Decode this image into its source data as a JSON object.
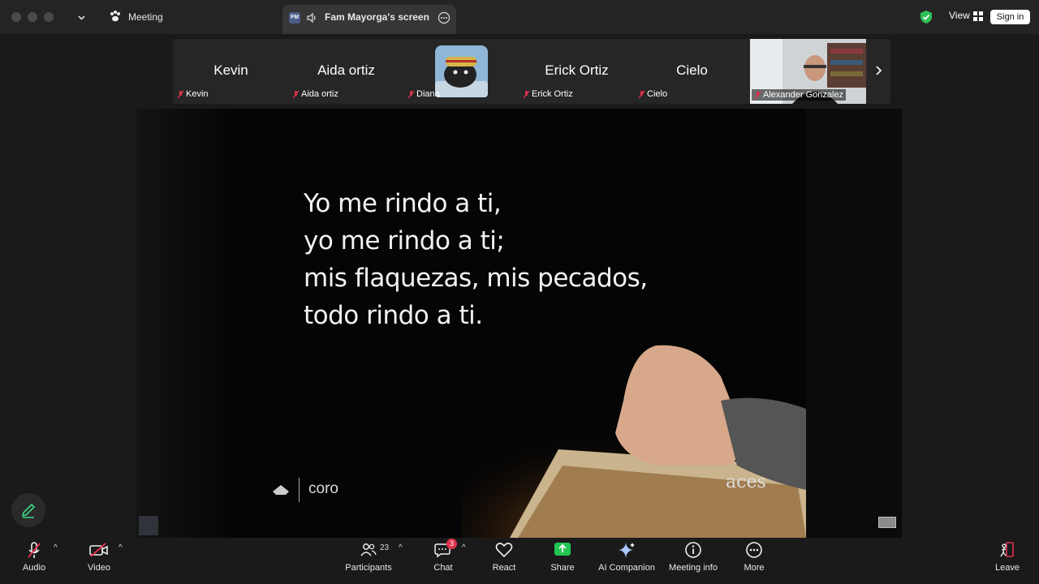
{
  "titlebar": {
    "meeting_label": "Meeting",
    "share_tab_badge": "FM",
    "share_tab_label": "Fam Mayorga's screen",
    "view_label": "View",
    "signin_label": "Sign in"
  },
  "participants_strip": [
    {
      "display": "Kevin",
      "name": "Kevin",
      "has_video": false
    },
    {
      "display": "Aida ortiz",
      "name": "Aida ortiz",
      "has_video": false
    },
    {
      "display": "",
      "name": "Diana",
      "has_video": true
    },
    {
      "display": "Erick Ortiz",
      "name": "Erick Ortiz",
      "has_video": false
    },
    {
      "display": "Cielo",
      "name": "Cielo",
      "has_video": false
    },
    {
      "display": "",
      "name": "Alexander Gonzalez",
      "has_video": true
    }
  ],
  "shared_screen": {
    "lyrics": [
      "Yo me rindo a ti,",
      "yo me rindo a ti;",
      "mis flaquezas, mis pecados,",
      "todo rindo a ti."
    ],
    "section_label": "coro",
    "watermark": "aces"
  },
  "toolbar": {
    "audio_label": "Audio",
    "video_label": "Video",
    "participants_label": "Participants",
    "participants_count": "23",
    "chat_label": "Chat",
    "chat_badge": "3",
    "react_label": "React",
    "share_label": "Share",
    "ai_label": "AI Companion",
    "info_label": "Meeting info",
    "more_label": "More",
    "leave_label": "Leave"
  },
  "colors": {
    "accent_red": "#e0314b",
    "share_green": "#23c552",
    "shield_green": "#2fbf57",
    "pencil_green": "#3ddc84"
  }
}
